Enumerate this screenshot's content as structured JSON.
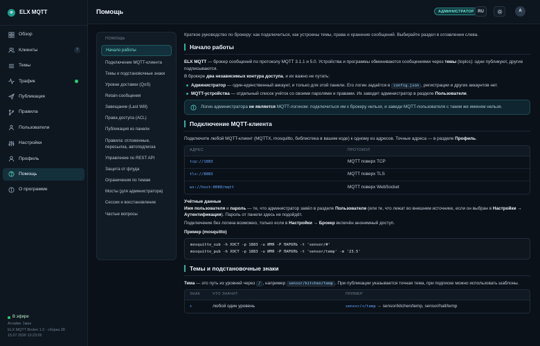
{
  "brand": {
    "name": "ELX MQTT"
  },
  "sidebar": {
    "items": [
      {
        "label": "Обзор",
        "icon": "grid-icon"
      },
      {
        "label": "Клиенты",
        "icon": "users-icon",
        "badge": "7"
      },
      {
        "label": "Темы",
        "icon": "lines-icon"
      },
      {
        "label": "Трафик",
        "icon": "activity-icon",
        "dot": true
      },
      {
        "label": "Публикация",
        "icon": "send-icon"
      },
      {
        "label": "Правила",
        "icon": "branch-icon"
      },
      {
        "label": "Пользователи",
        "icon": "user-group-icon"
      },
      {
        "label": "Настройки",
        "icon": "sliders-icon"
      },
      {
        "label": "Профиль",
        "icon": "profile-icon"
      },
      {
        "label": "Помощь",
        "icon": "help-icon",
        "active": true
      },
      {
        "label": "О программе",
        "icon": "info-icon"
      }
    ],
    "footer": {
      "status": "В эфире",
      "uptime": "Атлайм: 1мин",
      "version": "ELX MQTT Broker 1.0 · сборка 28",
      "datetime": "15.07.2026 13:23:05"
    }
  },
  "header": {
    "title": "Помощь",
    "role_badge": "АДМИНИСТРАТОР",
    "lang": "RU",
    "avatar": "A"
  },
  "toc": {
    "heading": "ПОМОЩЬ",
    "items": [
      "Начало работы",
      "Подключение MQTT-клиента",
      "Темы и подстановочные знаки",
      "Уровни доставки (QoS)",
      "Retain-сообщения",
      "Завещание (Last Will)",
      "Права доступа (ACL)",
      "Публикация из панели",
      "Правила: отложенные, пересылка, автоподписка",
      "Управление по REST API",
      "Защита от флуда",
      "Ограничения по темам",
      "Мосты (для администратора)",
      "Сессии и восстановление",
      "Частые вопросы"
    ]
  },
  "content": {
    "intro": "Краткое руководство по брокеру: как подключиться, как устроены темы, права и хранение сообщений. Выбирайте раздел в оглавлении слева.",
    "start": {
      "title": "Начало работы",
      "p1": {
        "b": "ELX MQTT",
        "t1": " — брокер сообщений по протоколу MQTT 3.1.1 и 5.0. Устройства и программы обмениваются сообщениями через ",
        "b2": "темы",
        "t2": " (topics): одни публикуют, другие подписываются."
      },
      "p2": {
        "t1": "В брокере ",
        "b": "два независимых контура доступа",
        "t2": ", и их важно не путать:"
      },
      "bullet1": {
        "b": "Администратор",
        "t1": " — один-единственный аккаунт, и только для этой панели. Его логин задаётся в ",
        "code": "config.json",
        "t2": ", регистрации и других аккаунтов нет."
      },
      "bullet2": {
        "b": "MQTT-устройства",
        "t1": " — отдельный список учёток со своими паролями и правами. Их заводит администратор в разделе ",
        "b2": "Пользователи",
        "t2": "."
      },
      "note": {
        "t1": "Логин администратора ",
        "b": "не является",
        "t2": " MQTT-логином: подключиться им к брокеру нельзя, и заведи MQTT-пользователя с таким же именем нельзя."
      }
    },
    "connect": {
      "title": "Подключение MQTT-клиента",
      "p1": {
        "t1": "Подключите любой MQTT-клиент (MQTTX, mosquitto, библиотека в вашем коде) к одному из адресов. Точные адреса — в разделе ",
        "b": "Профиль",
        "t2": "."
      },
      "table": {
        "headers": [
          "АДРЕС",
          "ПРОТОКОЛ"
        ],
        "rows": [
          [
            "tcp://1883",
            "MQTT поверх TCP"
          ],
          [
            "tls://8883",
            "MQTT поверх TLS"
          ],
          [
            "ws://host:8080/mqtt",
            "MQTT поверх WebSocket"
          ]
        ]
      },
      "creds_title": "Учётные данные",
      "creds_p1": {
        "b": "Имя пользователя",
        "t1": " и ",
        "b2": "пароль",
        "t2": " — те, что администратор завёл в разделе ",
        "b3": "Пользователи",
        "t3": " (или те, что лежат во внешнем источнике, если он выбран в ",
        "b4": "Настройки → Аутентификация",
        "t4": "). Пароль от панели здесь не подойдёт."
      },
      "creds_p2": {
        "t1": "Подключение без логина возможно, только если в ",
        "b": "Настройки → Брокер",
        "t2": " включён анонимный доступ."
      },
      "example_title": "Пример (mosquitto)",
      "code_lines": [
        "mosquitto_sub -h ХОСТ -p 1883 -u ИМЯ -P ПАРОЛЬ -t 'sensor/#'",
        "mosquitto_pub -h ХОСТ -p 1883 -u ИМЯ -P ПАРОЛЬ -t 'sensor/temp' -m '23.5'"
      ]
    },
    "topics": {
      "title": "Темы и подстановочные знаки",
      "p1": {
        "b": "Тема",
        "t1": " — это путь из уровней через ",
        "code1": "/",
        "t2": ", например ",
        "code2": "sensor/kitchen/temp",
        "t3": ". При публикации указывается точная тема, при подписке можно использовать шаблоны."
      },
      "table": {
        "headers": [
          "ЗНАК",
          "ЧТО ЗНАЧИТ",
          "ПРИМЕР"
        ],
        "rows": [
          {
            "sign": "+",
            "meaning": "любой один уровень",
            "ex_code": "sensor/+/temp",
            "ex_text": " → sensor/kitchen/temp, sensor/hall/temp"
          }
        ]
      }
    }
  },
  "colors": {
    "accent": "#2bb3a4",
    "background": "#0b1119",
    "sidebar": "#0e1720",
    "live": "#2ecc71"
  }
}
